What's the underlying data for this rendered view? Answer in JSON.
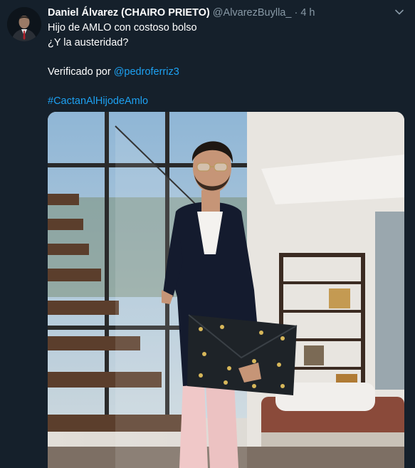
{
  "tweet": {
    "author_name": "Daniel Álvarez (CHAIRO PRIETO)",
    "author_handle": "@AlvarezBuylla_",
    "separator": "·",
    "timestamp": "4 h",
    "text_line1": "Hijo de AMLO con costoso bolso",
    "text_line2": "¿Y la austeridad?",
    "verified_prefix": "Verificado por ",
    "verified_mention": "@pedroferriz3",
    "hashtag": "#CactanAlHijodeAmlo"
  },
  "colors": {
    "background": "#15202b",
    "text": "#ffffff",
    "secondary": "#8899a6",
    "link": "#1da1f2"
  },
  "icons": [
    "avatar",
    "chevron-down-icon"
  ]
}
